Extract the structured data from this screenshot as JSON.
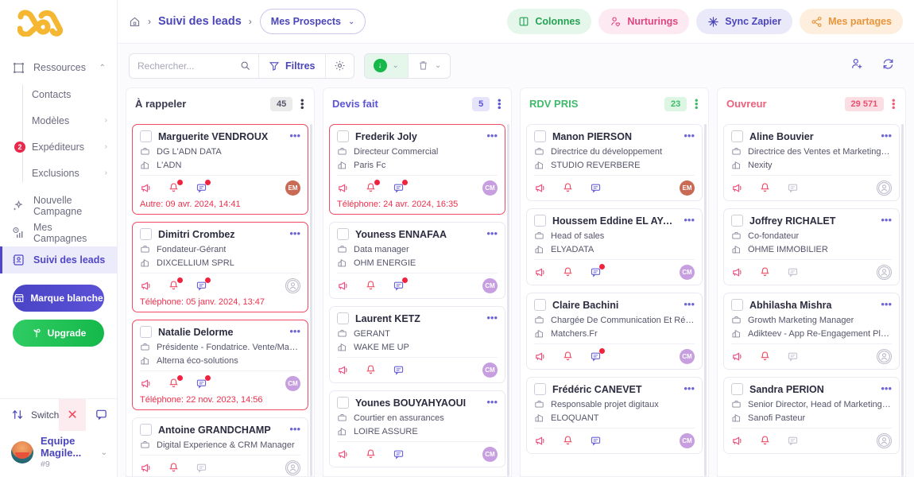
{
  "sidebar": {
    "logo": "magileads-logo",
    "nav": [
      {
        "label": "Ressources",
        "icon": "resources-icon",
        "chev": "⌃",
        "active": false
      },
      {
        "label": "Nouvelle Campagne",
        "icon": "sparkle-icon",
        "active": false
      },
      {
        "label": "Mes Campagnes",
        "icon": "chart-clock-icon",
        "active": false
      },
      {
        "label": "Suivi des leads",
        "icon": "contact-book-icon",
        "active": true
      }
    ],
    "subnav": [
      {
        "label": "Contacts",
        "chev": "",
        "badge": ""
      },
      {
        "label": "Modèles",
        "chev": "›",
        "badge": ""
      },
      {
        "label": "Expéditeurs",
        "chev": "›",
        "badge": "2"
      },
      {
        "label": "Exclusions",
        "chev": "›",
        "badge": ""
      }
    ],
    "white_label_button": "Marque blanche",
    "upgrade_button": "Upgrade",
    "switch_label": "Switch",
    "team_name": "Equipe Magile...",
    "team_id": "#9"
  },
  "header": {
    "home_icon": "home-icon",
    "breadcrumb_current": "Suivi des leads",
    "select_label": "Mes Prospects",
    "actions": [
      {
        "label": "Colonnes",
        "icon": "columns-icon",
        "style": "ap-green"
      },
      {
        "label": "Nurturings",
        "icon": "nurturing-icon",
        "style": "ap-pink"
      },
      {
        "label": "Sync Zapier",
        "icon": "zapier-icon",
        "style": "ap-blue"
      },
      {
        "label": "Mes partages",
        "icon": "share-icon",
        "style": "ap-orange"
      }
    ]
  },
  "toolbar": {
    "search_placeholder": "Rechercher...",
    "search_value": "",
    "filters_label": "Filtres",
    "gear_icon": "settings-gear-icon",
    "download_icon": "download-icon",
    "trash_icon": "trash-icon",
    "add_user_icon": "add-user-icon",
    "refresh_icon": "refresh-icon"
  },
  "board": {
    "columns": [
      {
        "title": "À rappeler",
        "count": "45",
        "title_color": "#3a3a50",
        "count_bg": "#ebebeb",
        "count_color": "#55556b",
        "cards": [
          {
            "name": "Marguerite VENDROUX",
            "role": "DG L'ADN DATA",
            "company": "L'ADN",
            "status": "Autre: 09 avr. 2024, 14:41",
            "hot": true,
            "avatar": "EM",
            "avatar_style": "av-em",
            "bell_dot": true,
            "chat_dot": true,
            "chat_active": true
          },
          {
            "name": "Dimitri Crombez",
            "role": "Fondateur-Gérant",
            "company": "DIXCELLIUM SPRL",
            "status": "Téléphone: 05 janv. 2024, 13:47",
            "hot": true,
            "avatar": "",
            "avatar_style": "av-empty",
            "bell_dot": true,
            "chat_dot": true,
            "chat_active": true
          },
          {
            "name": "Natalie Delorme",
            "role": "Présidente - Fondatrice. Vente/Marke...",
            "company": "Alterna éco-solutions",
            "status": "Téléphone: 22 nov. 2023, 14:56",
            "hot": true,
            "avatar": "CM",
            "avatar_style": "av-cm",
            "bell_dot": true,
            "chat_dot": true,
            "chat_active": true
          },
          {
            "name": "Antoine GRANDCHAMP",
            "role": "Digital Experience & CRM Manager",
            "company": "",
            "status": "",
            "hot": false,
            "avatar": "",
            "avatar_style": "av-empty",
            "bell_dot": false,
            "chat_dot": false,
            "chat_active": false
          }
        ]
      },
      {
        "title": "Devis fait",
        "count": "5",
        "title_color": "#5b54d6",
        "count_bg": "#e5e4fb",
        "count_color": "#5b54d6",
        "cards": [
          {
            "name": "Frederik Joly",
            "role": "Directeur Commercial",
            "company": "Paris Fc",
            "status": "Téléphone: 24 avr. 2024, 16:35",
            "hot": true,
            "avatar": "CM",
            "avatar_style": "av-cm",
            "bell_dot": true,
            "chat_dot": true,
            "chat_active": true
          },
          {
            "name": "Youness ENNAFAA",
            "role": "Data manager",
            "company": "OHM ENERGIE",
            "status": "",
            "hot": false,
            "avatar": "CM",
            "avatar_style": "av-cm",
            "bell_dot": false,
            "chat_dot": true,
            "chat_active": true
          },
          {
            "name": "Laurent KETZ",
            "role": "GERANT",
            "company": "WAKE ME UP",
            "status": "",
            "hot": false,
            "avatar": "CM",
            "avatar_style": "av-cm",
            "bell_dot": false,
            "chat_dot": false,
            "chat_active": true
          },
          {
            "name": "Younes BOUYAHYAOUI",
            "role": "Courtier en assurances",
            "company": "LOIRE ASSURE",
            "status": "",
            "hot": false,
            "avatar": "CM",
            "avatar_style": "av-cm",
            "bell_dot": false,
            "chat_dot": false,
            "chat_active": true
          }
        ]
      },
      {
        "title": "RDV PRIS",
        "count": "23",
        "title_color": "#3fba6a",
        "count_bg": "#ddf5e3",
        "count_color": "#3fba6a",
        "cards": [
          {
            "name": "Manon PIERSON",
            "role": "Directrice du développement",
            "company": "STUDIO REVERBERE",
            "status": "",
            "hot": false,
            "avatar": "EM",
            "avatar_style": "av-em",
            "bell_dot": false,
            "chat_dot": false,
            "chat_active": true
          },
          {
            "name": "Houssem Eddine EL AYADI",
            "role": "Head of sales",
            "company": "ELYADATA",
            "status": "",
            "hot": false,
            "avatar": "CM",
            "avatar_style": "av-cm",
            "bell_dot": false,
            "chat_dot": true,
            "chat_active": true
          },
          {
            "name": "Claire Bachini",
            "role": "Chargée De Communication Et Rédact...",
            "company": "Matchers.Fr",
            "status": "",
            "hot": false,
            "avatar": "CM",
            "avatar_style": "av-cm",
            "bell_dot": false,
            "chat_dot": true,
            "chat_active": true
          },
          {
            "name": "Frédéric CANEVET",
            "role": "Responsable projet digitaux",
            "company": "ELOQUANT",
            "status": "",
            "hot": false,
            "avatar": "CM",
            "avatar_style": "av-cm",
            "bell_dot": false,
            "chat_dot": false,
            "chat_active": true
          }
        ]
      },
      {
        "title": "Ouvreur",
        "count": "29 571",
        "title_color": "#f0607a",
        "count_bg": "#fbdde4",
        "count_color": "#e8516f",
        "cards": [
          {
            "name": "Aline Bouvier",
            "role": "Directrice des Ventes et Marketing ré...",
            "company": "Nexity",
            "status": "",
            "hot": false,
            "avatar": "",
            "avatar_style": "av-empty",
            "bell_dot": false,
            "chat_dot": false,
            "chat_active": false
          },
          {
            "name": "Joffrey RICHALET",
            "role": "Co-fondateur",
            "company": "ÔHME IMMOBILIER",
            "status": "",
            "hot": false,
            "avatar": "",
            "avatar_style": "av-empty",
            "bell_dot": false,
            "chat_dot": false,
            "chat_active": false
          },
          {
            "name": "Abhilasha Mishra",
            "role": "Growth Marketing Manager",
            "company": "Adikteev - App Re-Engagement Platfor...",
            "status": "",
            "hot": false,
            "avatar": "",
            "avatar_style": "av-empty",
            "bell_dot": false,
            "chat_dot": false,
            "chat_active": false
          },
          {
            "name": "Sandra PERION",
            "role": "Senior Director, Head of Marketing, Fl...",
            "company": "Sanofi Pasteur",
            "status": "",
            "hot": false,
            "avatar": "",
            "avatar_style": "av-empty",
            "bell_dot": false,
            "chat_dot": false,
            "chat_active": false
          }
        ]
      }
    ]
  }
}
